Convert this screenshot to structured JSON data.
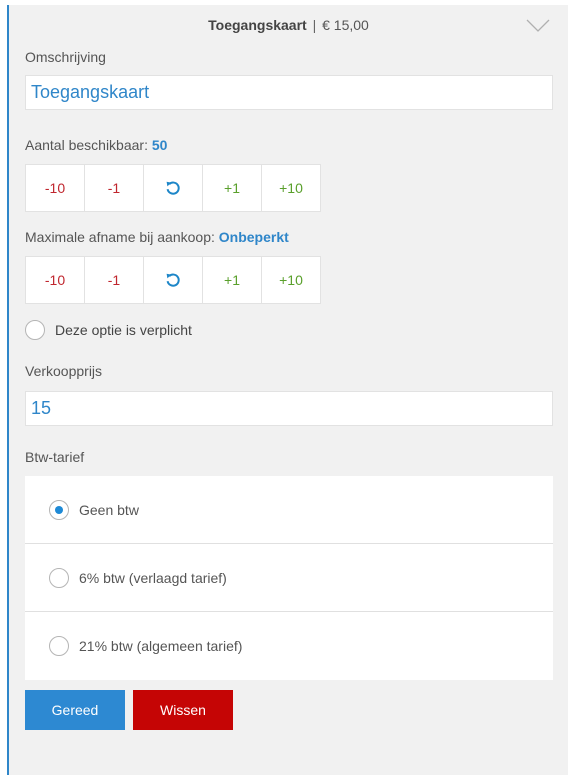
{
  "header": {
    "title": "Toegangskaart",
    "separator": "|",
    "price": "€ 15,00"
  },
  "description": {
    "label": "Omschrijving",
    "value": "Toegangskaart"
  },
  "available": {
    "label": "Aantal beschikbaar:",
    "value": "50",
    "steps": [
      "-10",
      "-1",
      "+1",
      "+10"
    ]
  },
  "max_purchase": {
    "label": "Maximale afname bij aankoop:",
    "value": "Onbeperkt",
    "steps": [
      "-10",
      "-1",
      "+1",
      "+10"
    ]
  },
  "required_option": {
    "label": "Deze optie is verplicht",
    "checked": false
  },
  "sale_price": {
    "label": "Verkoopprijs",
    "value": "15"
  },
  "vat": {
    "label": "Btw-tarief",
    "options": [
      "Geen btw",
      "6% btw (verlaagd tarief)",
      "21% btw (algemeen tarief)"
    ],
    "selected_index": 0
  },
  "buttons": {
    "done": "Gereed",
    "clear": "Wissen"
  },
  "colors": {
    "accent": "#2f86c9",
    "negative": "#c0262e",
    "positive": "#5aa02c",
    "done_button": "#2d89d2",
    "clear_button": "#c50505"
  }
}
